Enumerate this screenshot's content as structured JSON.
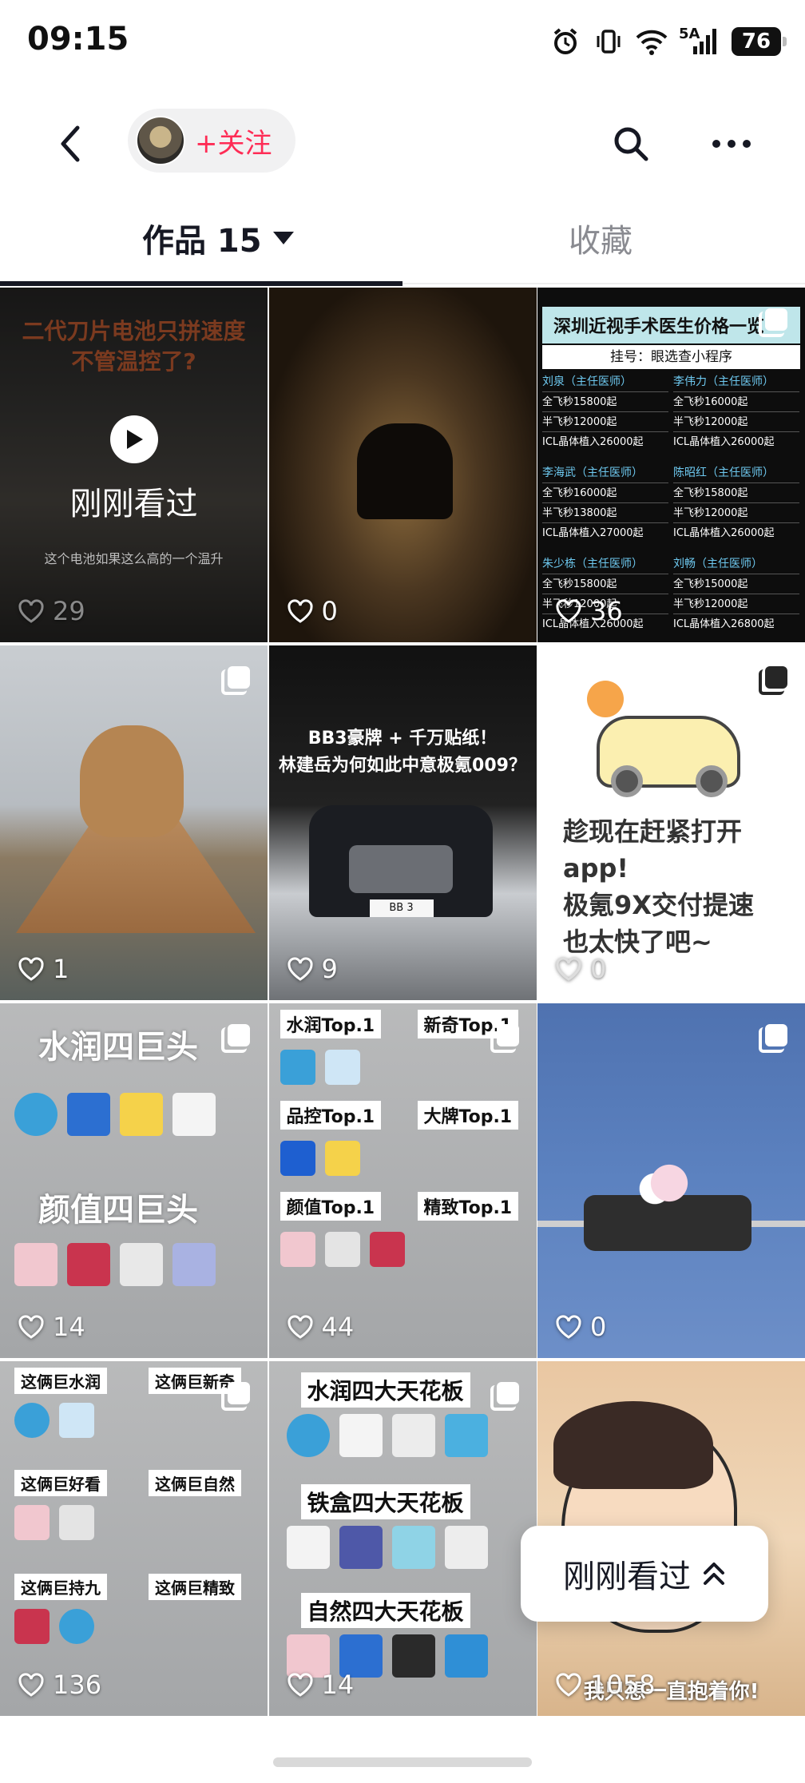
{
  "status_bar": {
    "time": "09:15",
    "network": "5A",
    "battery": "76",
    "icons": [
      "alarm-icon",
      "vibrate-icon",
      "wifi-icon",
      "signal-icon",
      "battery-icon"
    ]
  },
  "header": {
    "follow_label": "+关注",
    "icons": [
      "back-icon",
      "avatar",
      "search-icon",
      "more-icon"
    ]
  },
  "tabs": [
    {
      "label": "作品 15",
      "active": true
    },
    {
      "label": "收藏",
      "active": false
    }
  ],
  "tiles": [
    {
      "title": "二代刀片电池只拼速度\n不管温控了?",
      "overlay": "刚刚看过",
      "caption": "这个电池如果这么高的一个温升",
      "likes": "29"
    },
    {
      "likes": "0"
    },
    {
      "header": "深圳近视手术医生价格一览",
      "subheader": "挂号：眼选查小程序",
      "doctors": [
        {
          "name": "刘泉（主任医师）",
          "prices": [
            "全飞秒15800起",
            "半飞秒12000起",
            "ICL晶体植入26000起"
          ]
        },
        {
          "name": "李伟力（主任医师）",
          "prices": [
            "全飞秒16000起",
            "半飞秒12000起",
            "ICL晶体植入26000起"
          ]
        },
        {
          "name": "李海武（主任医师）",
          "prices": [
            "全飞秒16000起",
            "半飞秒13800起",
            "ICL晶体植入27000起"
          ]
        },
        {
          "name": "陈昭红（主任医师）",
          "prices": [
            "全飞秒15800起",
            "半飞秒12000起",
            "ICL晶体植入26000起"
          ]
        },
        {
          "name": "朱少栋（主任医师）",
          "prices": [
            "全飞秒15800起",
            "半飞秒12000起",
            "ICL晶体植入26000起"
          ]
        },
        {
          "name": "刘畅（主任医师）",
          "prices": [
            "全飞秒15000起",
            "半飞秒12000起",
            "ICL晶体植入26800起"
          ]
        }
      ],
      "likes": "36"
    },
    {
      "likes": "1"
    },
    {
      "title": "BB3豪牌 + 千万贴纸！\n林建岳为何如此中意极氪009？",
      "plate": "BB 3",
      "likes": "9"
    },
    {
      "text": "趁现在赶紧打开\napp!\n极氪9X交付提速\n也太快了吧~",
      "likes": "0"
    },
    {
      "line1": "水润四巨头",
      "line2": "颜值四巨头",
      "likes": "14"
    },
    {
      "labels": [
        "水润Top.1",
        "新奇Top.1",
        "品控Top.1",
        "大牌Top.1",
        "颜值Top.1",
        "精致Top.1"
      ],
      "likes": "44"
    },
    {
      "likes": "0"
    },
    {
      "labels": [
        "这俩巨水润",
        "这俩巨新奇",
        "这俩巨好看",
        "这俩巨自然",
        "这俩巨持九",
        "这俩巨精致"
      ],
      "likes": "136"
    },
    {
      "labels": [
        "水润四大天花板",
        "铁盒四大天花板",
        "自然四大天花板"
      ],
      "likes": "14"
    },
    {
      "caption": "我只想一直抱着你!",
      "likes": "1058"
    }
  ],
  "recent_button": {
    "label": "刚刚看过"
  },
  "colors": {
    "accent": "#fe2c55",
    "text": "#161823",
    "muted": "#8a8b91"
  }
}
